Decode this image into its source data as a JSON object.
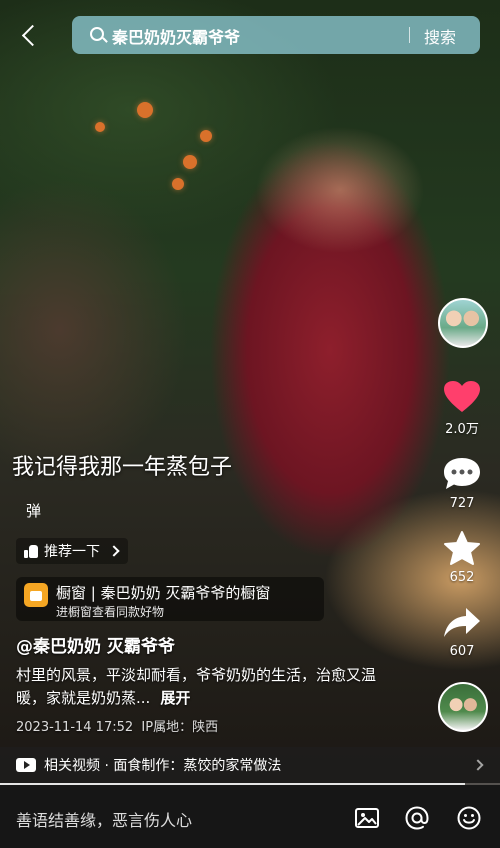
{
  "search": {
    "query": "秦巴奶奶灭霸爷爷",
    "button_label": "搜索"
  },
  "video": {
    "overlay_title": "我记得我那一年蒸包子",
    "danmaku_label": "弹"
  },
  "rail": {
    "like_count": "2.0万",
    "comment_count": "727",
    "favorite_count": "652",
    "share_count": "607",
    "like_color": "#ff3f6c"
  },
  "recommend": {
    "label": "推荐一下"
  },
  "shop": {
    "title": "橱窗 | 秦巴奶奶 灭霸爷爷的橱窗",
    "subtitle": "进橱窗查看同款好物"
  },
  "post": {
    "author": "@秦巴奶奶 灭霸爷爷",
    "description": "村里的风景，平淡却耐看，爷爷奶奶的生活，治愈又温暖，家就是奶奶蒸...",
    "expand_label": "展开",
    "timestamp": "2023-11-14 17:52",
    "location": "IP属地：陕西"
  },
  "related": {
    "text": "相关视频 · 面食制作：蒸饺的家常做法"
  },
  "playback": {
    "progress": 0.93
  },
  "comment_bar": {
    "placeholder": "善语结善缘，恶言伤人心"
  }
}
